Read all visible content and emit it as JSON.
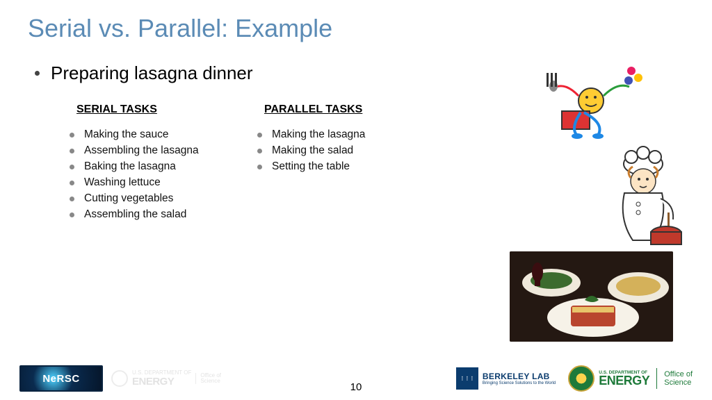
{
  "title": "Serial vs. Parallel: Example",
  "main_bullet": "Preparing lasagna dinner",
  "serial": {
    "heading": "SERIAL TASKS",
    "items": [
      "Making the sauce",
      "Assembling the lasagna",
      "Baking the lasagna",
      "Washing lettuce",
      "Cutting vegetables",
      "Assembling the salad"
    ]
  },
  "parallel": {
    "heading": "PARALLEL TASKS",
    "items": [
      "Making the lasagna",
      "Making the salad",
      "Setting the table"
    ]
  },
  "page_number": "10",
  "logos": {
    "nersc": "NeRSC",
    "energy_dept": "U.S. DEPARTMENT OF",
    "energy": "ENERGY",
    "office": "Office of",
    "science": "Science",
    "berkeley": "BERKELEY LAB",
    "berkeley_tag": "Bringing Science Solutions to the World"
  }
}
